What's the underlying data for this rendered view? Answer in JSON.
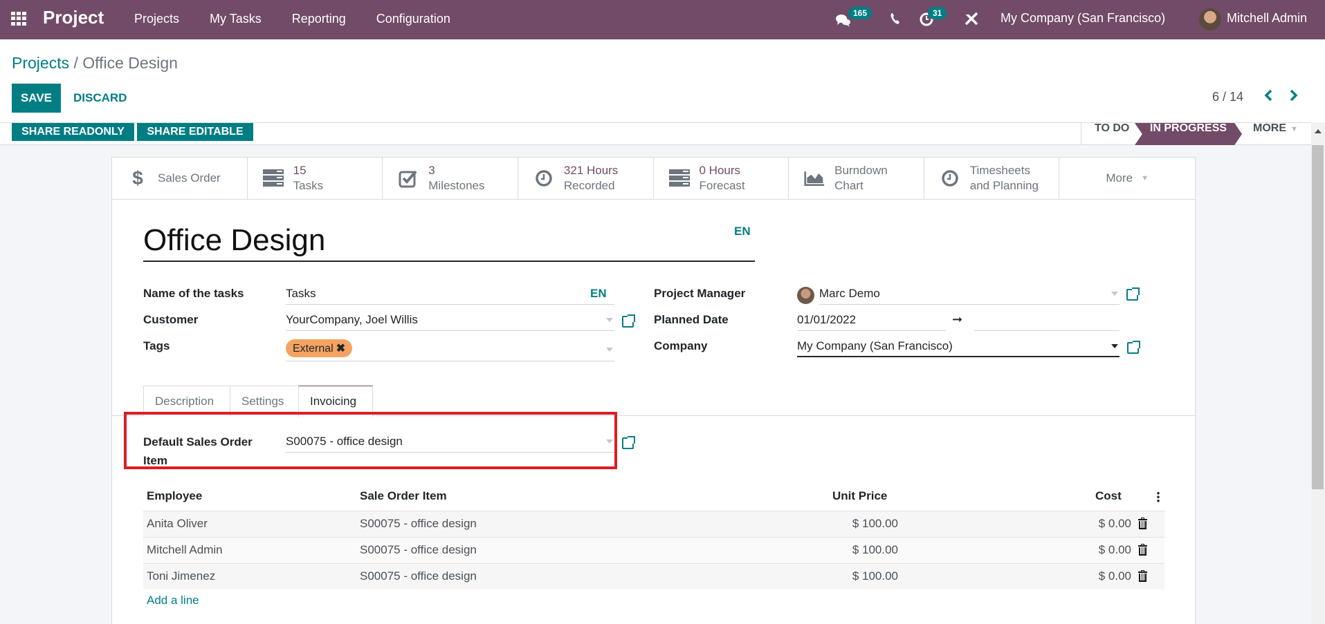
{
  "navbar": {
    "app_name": "Project",
    "menu": [
      "Projects",
      "My Tasks",
      "Reporting",
      "Configuration"
    ],
    "messages_count": "165",
    "activities_count": "31",
    "company": "My Company (San Francisco)",
    "user": "Mitchell Admin",
    "icons": [
      "apps-grid-icon",
      "chat-icon",
      "phone-icon",
      "clock-icon",
      "tools-icon"
    ]
  },
  "breadcrumb": {
    "parent": "Projects",
    "separator": "/",
    "current": "Office Design"
  },
  "actions": {
    "save": "SAVE",
    "discard": "DISCARD"
  },
  "pager": {
    "value": "6 / 14",
    "prev": "‹",
    "next": "›"
  },
  "statusbar": {
    "share_readonly": "SHARE READONLY",
    "share_editable": "SHARE EDITABLE",
    "stages": [
      "TO DO",
      "IN PROGRESS",
      "MORE"
    ],
    "active_stage": "IN PROGRESS"
  },
  "smart_buttons": [
    {
      "icon": "dollar-icon",
      "value": "",
      "label": "Sales Order"
    },
    {
      "icon": "tasks-icon",
      "value": "15",
      "label": "Tasks"
    },
    {
      "icon": "checkbox-icon",
      "value": "3",
      "label": "Milestones"
    },
    {
      "icon": "clock-icon",
      "value": "321 Hours",
      "label": "Recorded"
    },
    {
      "icon": "tasks-icon",
      "value": "0 Hours",
      "label": "Forecast"
    },
    {
      "icon": "area-chart-icon",
      "value": "Burndown",
      "label": "Chart"
    },
    {
      "icon": "clock-icon",
      "value": "Timesheets",
      "label": "and Planning"
    },
    {
      "icon": "caret-down-icon",
      "value": "",
      "label": "More"
    }
  ],
  "form": {
    "title": "Office Design",
    "title_lang": "EN",
    "name_of_tasks_label": "Name of the tasks",
    "name_of_tasks_value": "Tasks",
    "name_of_tasks_lang": "EN",
    "customer_label": "Customer",
    "customer_value": "YourCompany, Joel Willis",
    "tags_label": "Tags",
    "tags": [
      "External"
    ],
    "tag_color": "#F4A460",
    "project_manager_label": "Project Manager",
    "project_manager_value": "Marc Demo",
    "planned_date_label": "Planned Date",
    "planned_date_start": "01/01/2022",
    "planned_date_arrow": "➞",
    "planned_date_end": "",
    "company_label": "Company",
    "company_value": "My Company (San Francisco)"
  },
  "notebook": {
    "tabs": [
      "Description",
      "Settings",
      "Invoicing"
    ],
    "active_tab": "Invoicing"
  },
  "invoicing": {
    "default_so_item_label_1": "Default Sales Order",
    "default_so_item_label_2": "Item",
    "default_so_item_value": "S00075 - office design",
    "table": {
      "columns": [
        "Employee",
        "Sale Order Item",
        "Unit Price",
        "Cost"
      ],
      "rows": [
        {
          "employee": "Anita Oliver",
          "so_item": "S00075 - office design",
          "unit_price": "$ 100.00",
          "cost": "$ 0.00"
        },
        {
          "employee": "Mitchell Admin",
          "so_item": "S00075 - office design",
          "unit_price": "$ 100.00",
          "cost": "$ 0.00"
        },
        {
          "employee": "Toni Jimenez",
          "so_item": "S00075 - office design",
          "unit_price": "$ 100.00",
          "cost": "$ 0.00"
        }
      ],
      "add_line": "Add a line"
    }
  },
  "colors": {
    "brand": "#714B67",
    "accent": "#017E84",
    "highlight": "#e01b24"
  }
}
